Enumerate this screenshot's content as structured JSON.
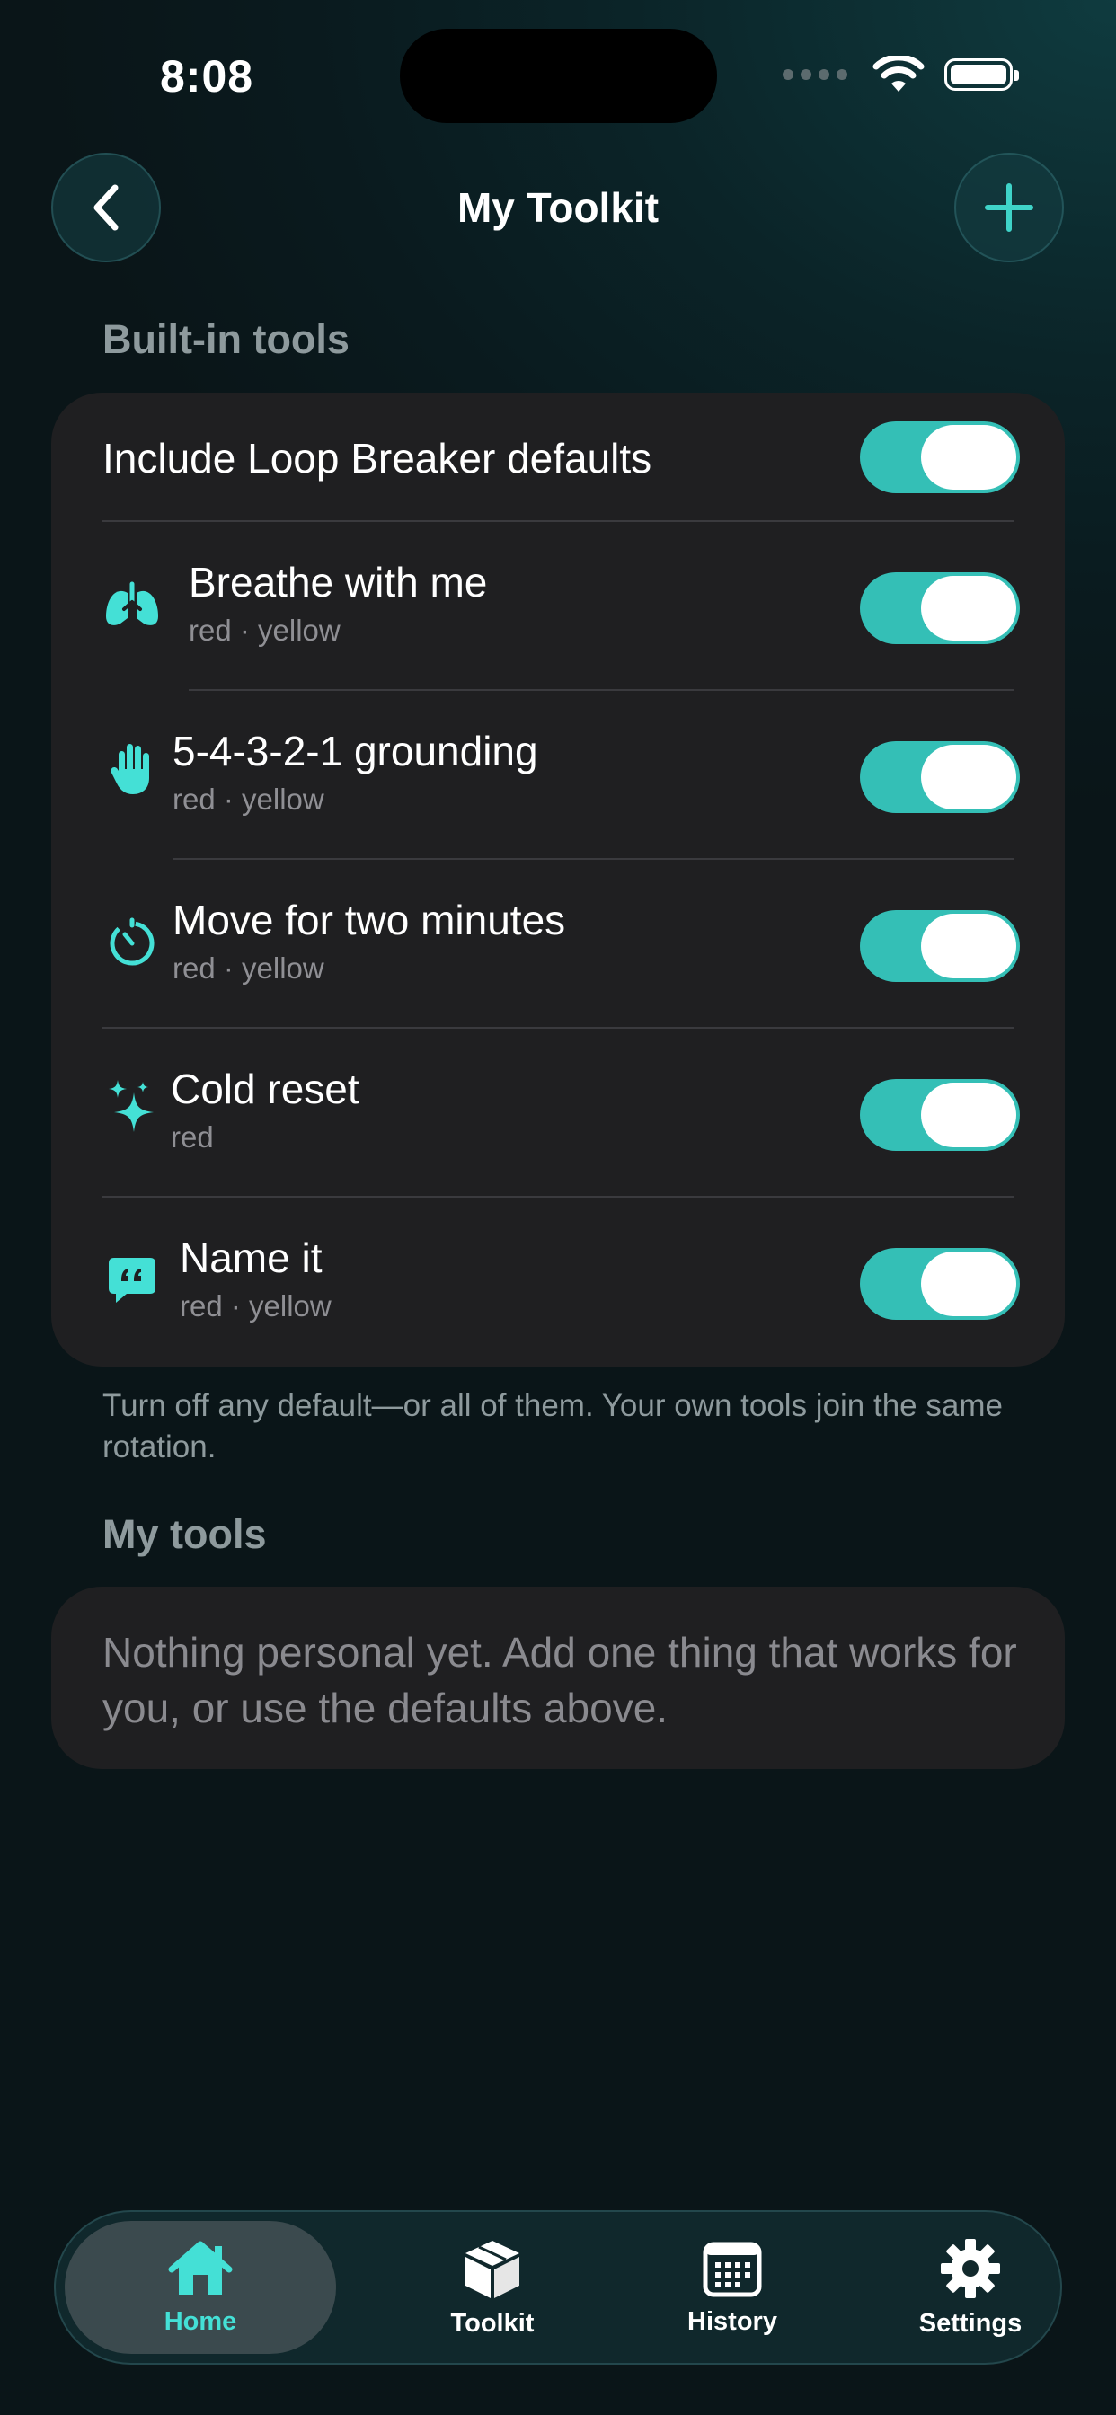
{
  "status_bar": {
    "time": "8:08"
  },
  "header": {
    "title": "My Toolkit",
    "back_icon": "chevron-left-icon",
    "add_icon": "plus-icon"
  },
  "builtin": {
    "section_title": "Built-in tools",
    "master_toggle": {
      "label": "Include Loop Breaker defaults",
      "on": true
    },
    "tools": [
      {
        "label": "Breathe with me",
        "tags": "red · yellow",
        "icon": "lungs-icon",
        "on": true
      },
      {
        "label": "5-4-3-2-1 grounding",
        "tags": "red · yellow",
        "icon": "hand-icon",
        "on": true
      },
      {
        "label": "Move for two minutes",
        "tags": "red · yellow",
        "icon": "timer-icon",
        "on": true
      },
      {
        "label": "Cold reset",
        "tags": "red",
        "icon": "sparkle-icon",
        "on": true
      },
      {
        "label": "Name it",
        "tags": "red · yellow",
        "icon": "quote-bubble-icon",
        "on": true
      }
    ],
    "footnote": "Turn off any default—or all of them. Your own tools join the same rotation."
  },
  "my_tools": {
    "section_title": "My tools",
    "empty_text": "Nothing personal yet. Add one thing that works for you, or use the defaults above."
  },
  "tab_bar": {
    "tabs": [
      {
        "label": "Home",
        "icon": "home-icon",
        "active": true
      },
      {
        "label": "Toolkit",
        "icon": "box-icon",
        "active": false
      },
      {
        "label": "History",
        "icon": "calendar-icon",
        "active": false
      },
      {
        "label": "Settings",
        "icon": "gear-icon",
        "active": false
      }
    ]
  },
  "colors": {
    "accent": "#34bfb6",
    "icon_accent": "#44e0d6",
    "card": "#1f1f21"
  }
}
